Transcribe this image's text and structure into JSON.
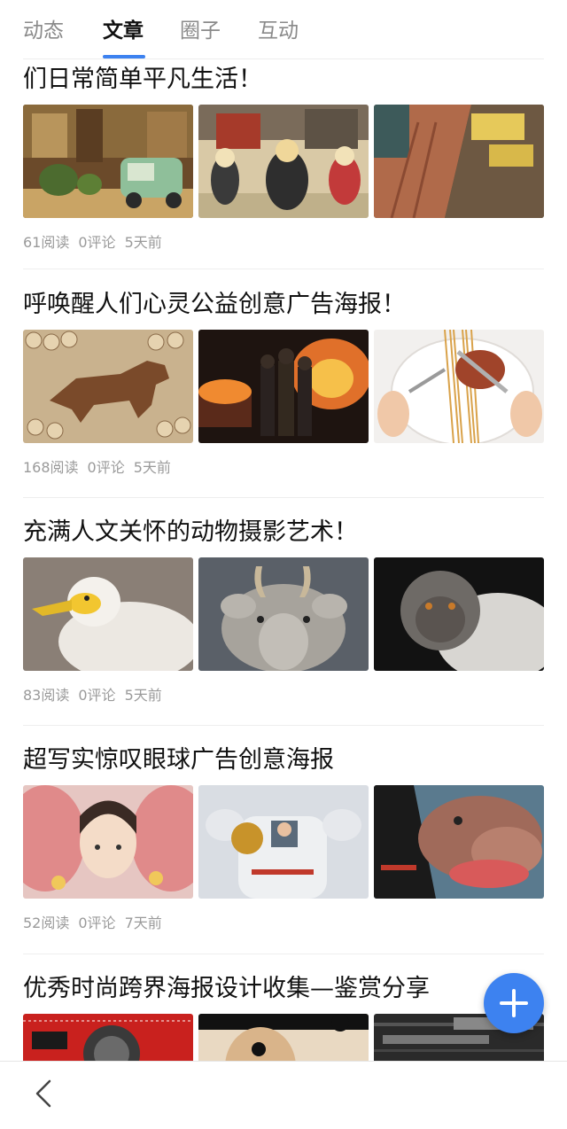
{
  "tabs": [
    "动态",
    "文章",
    "圈子",
    "互动"
  ],
  "active_tab": "文章",
  "articles": [
    {
      "title": "们日常简单平凡生活！",
      "reads": "61阅读",
      "comments": "0评论",
      "time": "5天前",
      "images": [
        "illustrated-street-scene-with-green-car",
        "illustrated-characters-in-market",
        "illustrated-waterside-boardwalk"
      ]
    },
    {
      "title": "呼唤醒人们心灵公益创意广告海报！",
      "reads": "168阅读",
      "comments": "0评论",
      "time": "5天前",
      "images": [
        "wolf-made-of-logs",
        "firefighters-in-fire",
        "fork-and-knife-on-plate"
      ]
    },
    {
      "title": "充满人文关怀的动物摄影艺术！",
      "reads": "83阅读",
      "comments": "0评论",
      "time": "5天前",
      "images": [
        "white-vulture-portrait",
        "saiga-antelope-portrait",
        "monkey-portrait"
      ]
    },
    {
      "title": "超写实惊叹眼球广告创意海报",
      "reads": "52阅读",
      "comments": "0评论",
      "time": "7天前",
      "images": [
        "girl-face-between-cheeks",
        "child-in-astronaut-suit",
        "hippo-in-car-window"
      ]
    },
    {
      "title": "优秀时尚跨界海报设计收集—鉴赏分享",
      "images": [
        "red-poster-with-face",
        "vintage-portrait-poster",
        "dark-typographic-poster"
      ]
    }
  ],
  "icons": {
    "fab": "plus-icon",
    "back": "chevron-left-icon"
  },
  "colors": {
    "accent": "#3d82f0",
    "meta_text": "#9a9a9a"
  }
}
